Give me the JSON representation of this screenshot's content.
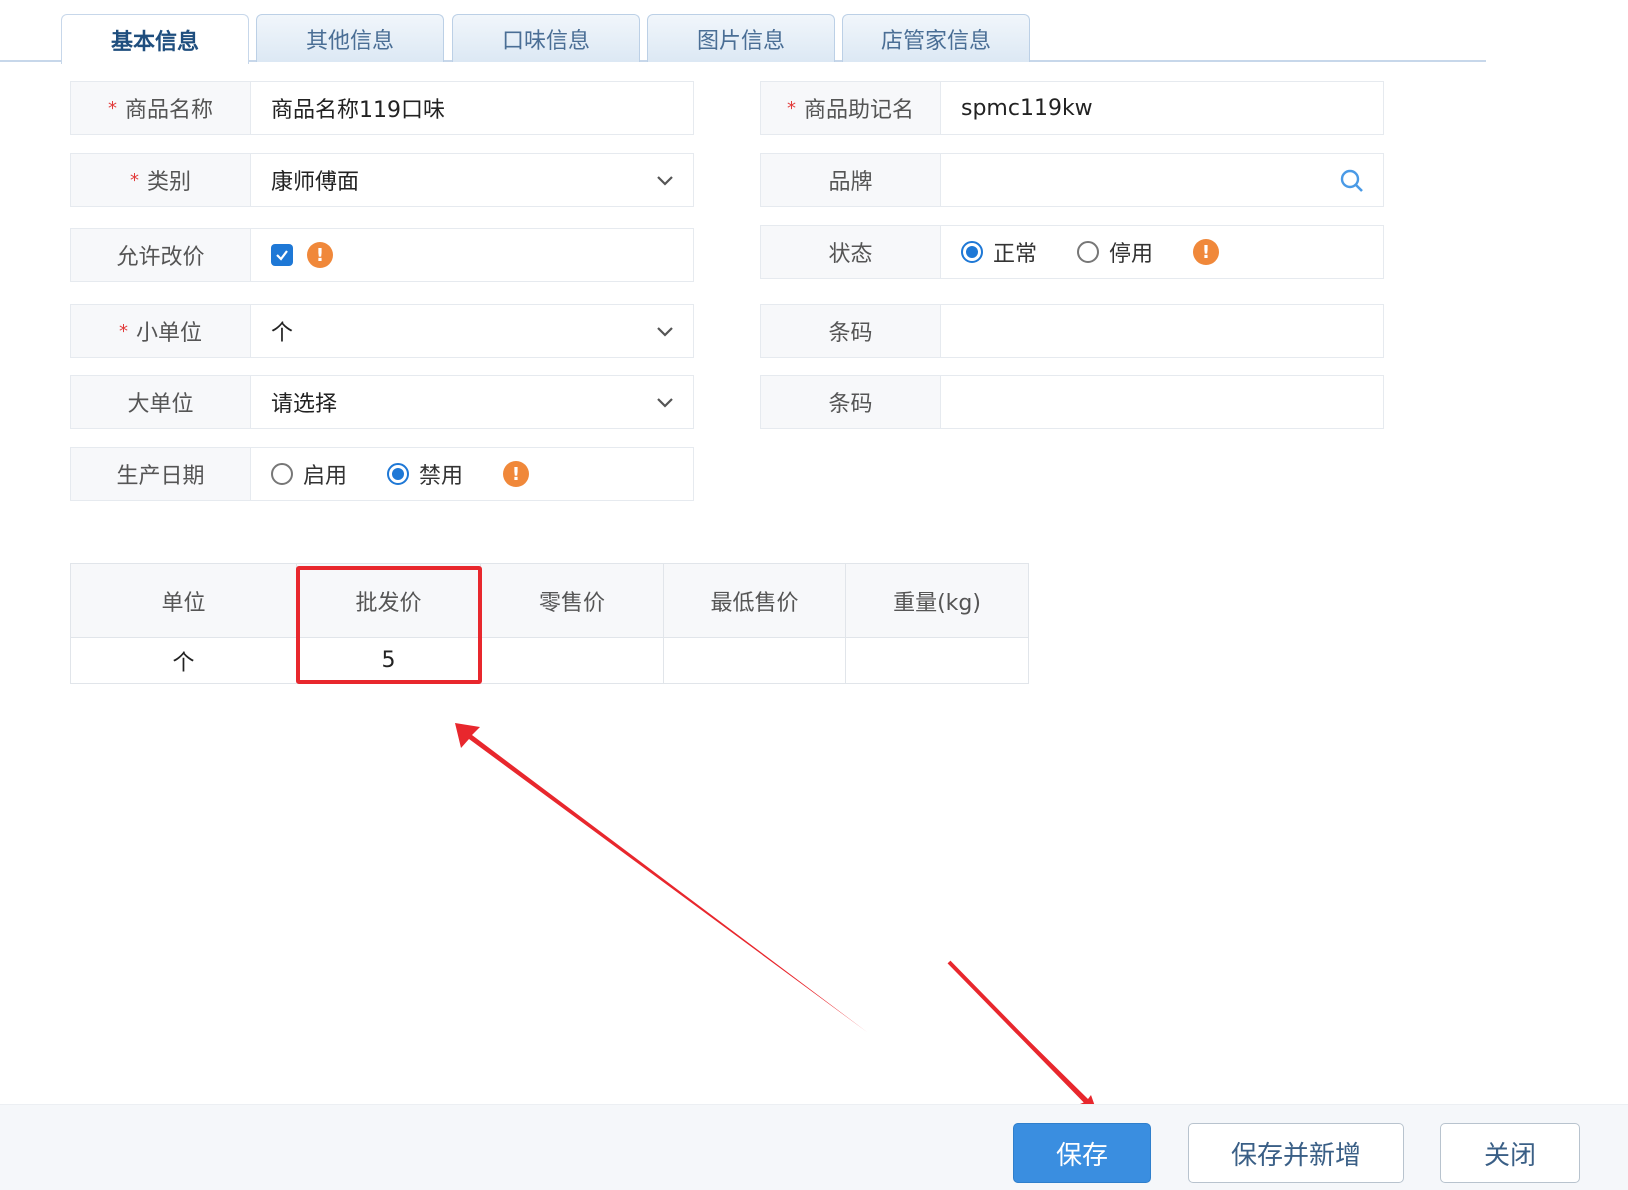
{
  "tabs": [
    "基本信息",
    "其他信息",
    "口味信息",
    "图片信息",
    "店管家信息"
  ],
  "form": {
    "product_name": {
      "label": "商品名称",
      "value": "商品名称119口味"
    },
    "mnemonic": {
      "label": "商品助记名",
      "value": "spmc119kw"
    },
    "category": {
      "label": "类别",
      "value": "康师傅面"
    },
    "brand": {
      "label": "品牌",
      "value": ""
    },
    "allow_price_change": {
      "label": "允许改价",
      "checked": true
    },
    "status": {
      "label": "状态",
      "options": [
        "正常",
        "停用"
      ],
      "selected": "正常"
    },
    "small_unit": {
      "label": "小单位",
      "value": "个"
    },
    "barcode1": {
      "label": "条码",
      "value": ""
    },
    "large_unit": {
      "label": "大单位",
      "value": "请选择"
    },
    "barcode2": {
      "label": "条码",
      "value": ""
    },
    "production_date": {
      "label": "生产日期",
      "options": [
        "启用",
        "禁用"
      ],
      "selected": "禁用"
    }
  },
  "price_table": {
    "headers": [
      "单位",
      "批发价",
      "零售价",
      "最低售价",
      "重量(kg)"
    ],
    "rows": [
      [
        "个",
        "5",
        "",
        "",
        ""
      ]
    ]
  },
  "footer": {
    "save": "保存",
    "save_new": "保存并新增",
    "close": "关闭"
  },
  "colors": {
    "primary": "#3a8ee0",
    "required": "#e23b3b",
    "warning": "#f0883a",
    "annotation": "#e8272d"
  }
}
